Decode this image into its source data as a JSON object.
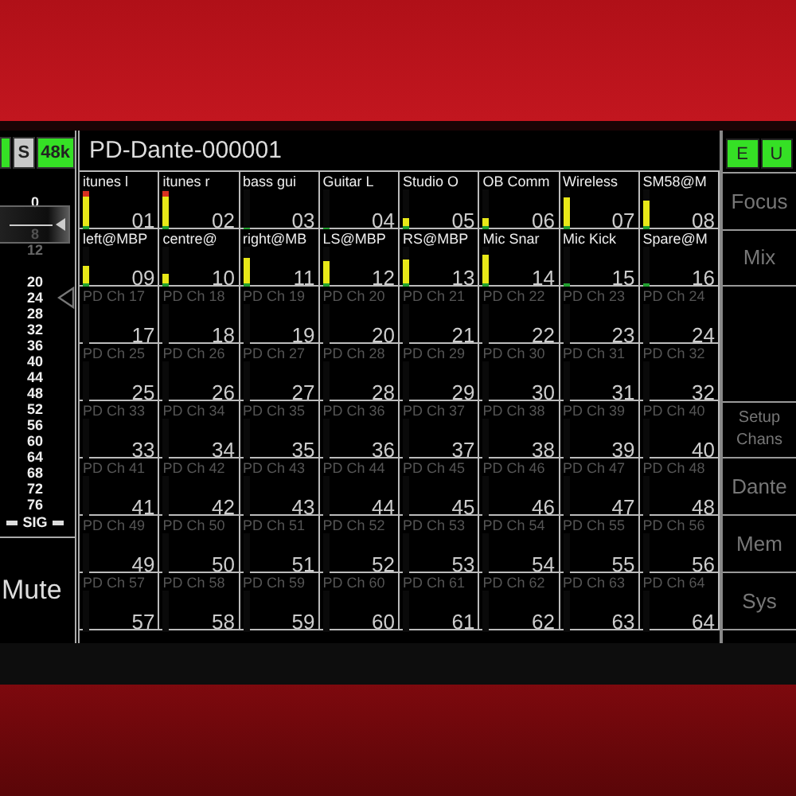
{
  "device_name": "PD-Dante-000001",
  "status_buttons": [
    {
      "on": true
    },
    {
      "label": "S",
      "on": false
    },
    {
      "label": "48k",
      "on": true
    }
  ],
  "mode_buttons": [
    {
      "label": "E",
      "on": true
    },
    {
      "label": "U",
      "on": true
    }
  ],
  "fader": {
    "scale": [
      "0",
      "8",
      "12",
      "20",
      "24",
      "28",
      "32",
      "36",
      "40",
      "44",
      "48",
      "52",
      "56",
      "60",
      "64",
      "68",
      "72",
      "76"
    ],
    "signal_label": "SIG",
    "level": 0.86
  },
  "mute_label": "Mute",
  "side_menu": [
    "Focus",
    "Mix",
    "Setup Chans",
    "Dante",
    "Mem",
    "Sys"
  ],
  "channels": [
    {
      "name": "itunes l",
      "number": "01",
      "active": true,
      "level": 0.95
    },
    {
      "name": "itunes r",
      "number": "02",
      "active": true,
      "level": 0.95
    },
    {
      "name": "bass gui",
      "number": "03",
      "active": true,
      "level": 0.06
    },
    {
      "name": "Guitar L",
      "number": "04",
      "active": true,
      "level": 0.06
    },
    {
      "name": "Studio O",
      "number": "05",
      "active": true,
      "level": 0.3
    },
    {
      "name": "OB Comm",
      "number": "06",
      "active": true,
      "level": 0.3
    },
    {
      "name": "Wireless",
      "number": "07",
      "active": true,
      "level": 0.8
    },
    {
      "name": "SM58@M",
      "number": "08",
      "active": true,
      "level": 0.75
    },
    {
      "name": "left@MBP",
      "number": "09",
      "active": true,
      "level": 0.55
    },
    {
      "name": "centre@",
      "number": "10",
      "active": true,
      "level": 0.35
    },
    {
      "name": "right@MB",
      "number": "11",
      "active": true,
      "level": 0.75
    },
    {
      "name": "LS@MBP",
      "number": "12",
      "active": true,
      "level": 0.65
    },
    {
      "name": "RS@MBP",
      "number": "13",
      "active": true,
      "level": 0.7
    },
    {
      "name": "Mic Snar",
      "number": "14",
      "active": true,
      "level": 0.8
    },
    {
      "name": "Mic Kick",
      "number": "15",
      "active": true,
      "level": 0.1
    },
    {
      "name": "Spare@M",
      "number": "16",
      "active": true,
      "level": 0.12
    },
    {
      "name": "PD Ch 17",
      "number": "17",
      "active": false
    },
    {
      "name": "PD Ch 18",
      "number": "18",
      "active": false
    },
    {
      "name": "PD Ch 19",
      "number": "19",
      "active": false
    },
    {
      "name": "PD Ch 20",
      "number": "20",
      "active": false
    },
    {
      "name": "PD Ch 21",
      "number": "21",
      "active": false
    },
    {
      "name": "PD Ch 22",
      "number": "22",
      "active": false
    },
    {
      "name": "PD Ch 23",
      "number": "23",
      "active": false
    },
    {
      "name": "PD Ch 24",
      "number": "24",
      "active": false
    },
    {
      "name": "PD Ch 25",
      "number": "25",
      "active": false
    },
    {
      "name": "PD Ch 26",
      "number": "26",
      "active": false
    },
    {
      "name": "PD Ch 27",
      "number": "27",
      "active": false
    },
    {
      "name": "PD Ch 28",
      "number": "28",
      "active": false
    },
    {
      "name": "PD Ch 29",
      "number": "29",
      "active": false
    },
    {
      "name": "PD Ch 30",
      "number": "30",
      "active": false
    },
    {
      "name": "PD Ch 31",
      "number": "31",
      "active": false
    },
    {
      "name": "PD Ch 32",
      "number": "32",
      "active": false
    },
    {
      "name": "PD Ch 33",
      "number": "33",
      "active": false
    },
    {
      "name": "PD Ch 34",
      "number": "34",
      "active": false
    },
    {
      "name": "PD Ch 35",
      "number": "35",
      "active": false
    },
    {
      "name": "PD Ch 36",
      "number": "36",
      "active": false
    },
    {
      "name": "PD Ch 37",
      "number": "37",
      "active": false
    },
    {
      "name": "PD Ch 38",
      "number": "38",
      "active": false
    },
    {
      "name": "PD Ch 39",
      "number": "39",
      "active": false
    },
    {
      "name": "PD Ch 40",
      "number": "40",
      "active": false
    },
    {
      "name": "PD Ch 41",
      "number": "41",
      "active": false
    },
    {
      "name": "PD Ch 42",
      "number": "42",
      "active": false
    },
    {
      "name": "PD Ch 43",
      "number": "43",
      "active": false
    },
    {
      "name": "PD Ch 44",
      "number": "44",
      "active": false
    },
    {
      "name": "PD Ch 45",
      "number": "45",
      "active": false
    },
    {
      "name": "PD Ch 46",
      "number": "46",
      "active": false
    },
    {
      "name": "PD Ch 47",
      "number": "47",
      "active": false
    },
    {
      "name": "PD Ch 48",
      "number": "48",
      "active": false
    },
    {
      "name": "PD Ch 49",
      "number": "49",
      "active": false
    },
    {
      "name": "PD Ch 50",
      "number": "50",
      "active": false
    },
    {
      "name": "PD Ch 51",
      "number": "51",
      "active": false
    },
    {
      "name": "PD Ch 52",
      "number": "52",
      "active": false
    },
    {
      "name": "PD Ch 53",
      "number": "53",
      "active": false
    },
    {
      "name": "PD Ch 54",
      "number": "54",
      "active": false
    },
    {
      "name": "PD Ch 55",
      "number": "55",
      "active": false
    },
    {
      "name": "PD Ch 56",
      "number": "56",
      "active": false
    },
    {
      "name": "PD Ch 57",
      "number": "57",
      "active": false
    },
    {
      "name": "PD Ch 58",
      "number": "58",
      "active": false
    },
    {
      "name": "PD Ch 59",
      "number": "59",
      "active": false
    },
    {
      "name": "PD Ch 60",
      "number": "60",
      "active": false
    },
    {
      "name": "PD Ch 61",
      "number": "61",
      "active": false
    },
    {
      "name": "PD Ch 62",
      "number": "62",
      "active": false
    },
    {
      "name": "PD Ch 63",
      "number": "63",
      "active": false
    },
    {
      "name": "PD Ch 64",
      "number": "64",
      "active": false
    }
  ]
}
